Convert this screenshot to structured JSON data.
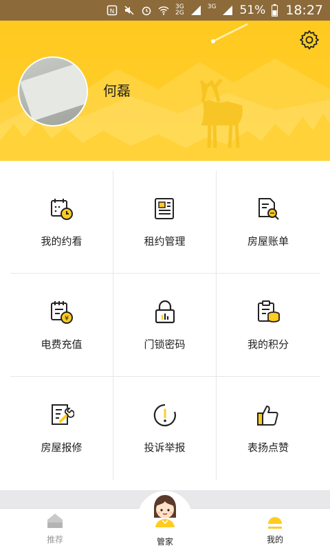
{
  "status_bar": {
    "network": [
      "3G",
      "3G",
      "2G"
    ],
    "battery": "51%",
    "time": "18:27"
  },
  "profile": {
    "name": "何磊"
  },
  "services": [
    {
      "label": "我的约看",
      "icon": "calendar-clock-icon"
    },
    {
      "label": "租约管理",
      "icon": "contract-document-icon"
    },
    {
      "label": "房屋账单",
      "icon": "bill-search-icon"
    },
    {
      "label": "电费充值",
      "icon": "electricity-recharge-icon"
    },
    {
      "label": "门锁密码",
      "icon": "lock-icon"
    },
    {
      "label": "我的积分",
      "icon": "points-coins-icon"
    },
    {
      "label": "房屋报修",
      "icon": "repair-wrench-icon"
    },
    {
      "label": "投诉举报",
      "icon": "complaint-exclamation-icon"
    },
    {
      "label": "表扬点赞",
      "icon": "thumbs-up-icon"
    }
  ],
  "tabs": {
    "left": "推荐",
    "center": "管家",
    "right": "我的"
  },
  "colors": {
    "accent": "#ffcc22",
    "status_bar": "#8c6a3a"
  }
}
